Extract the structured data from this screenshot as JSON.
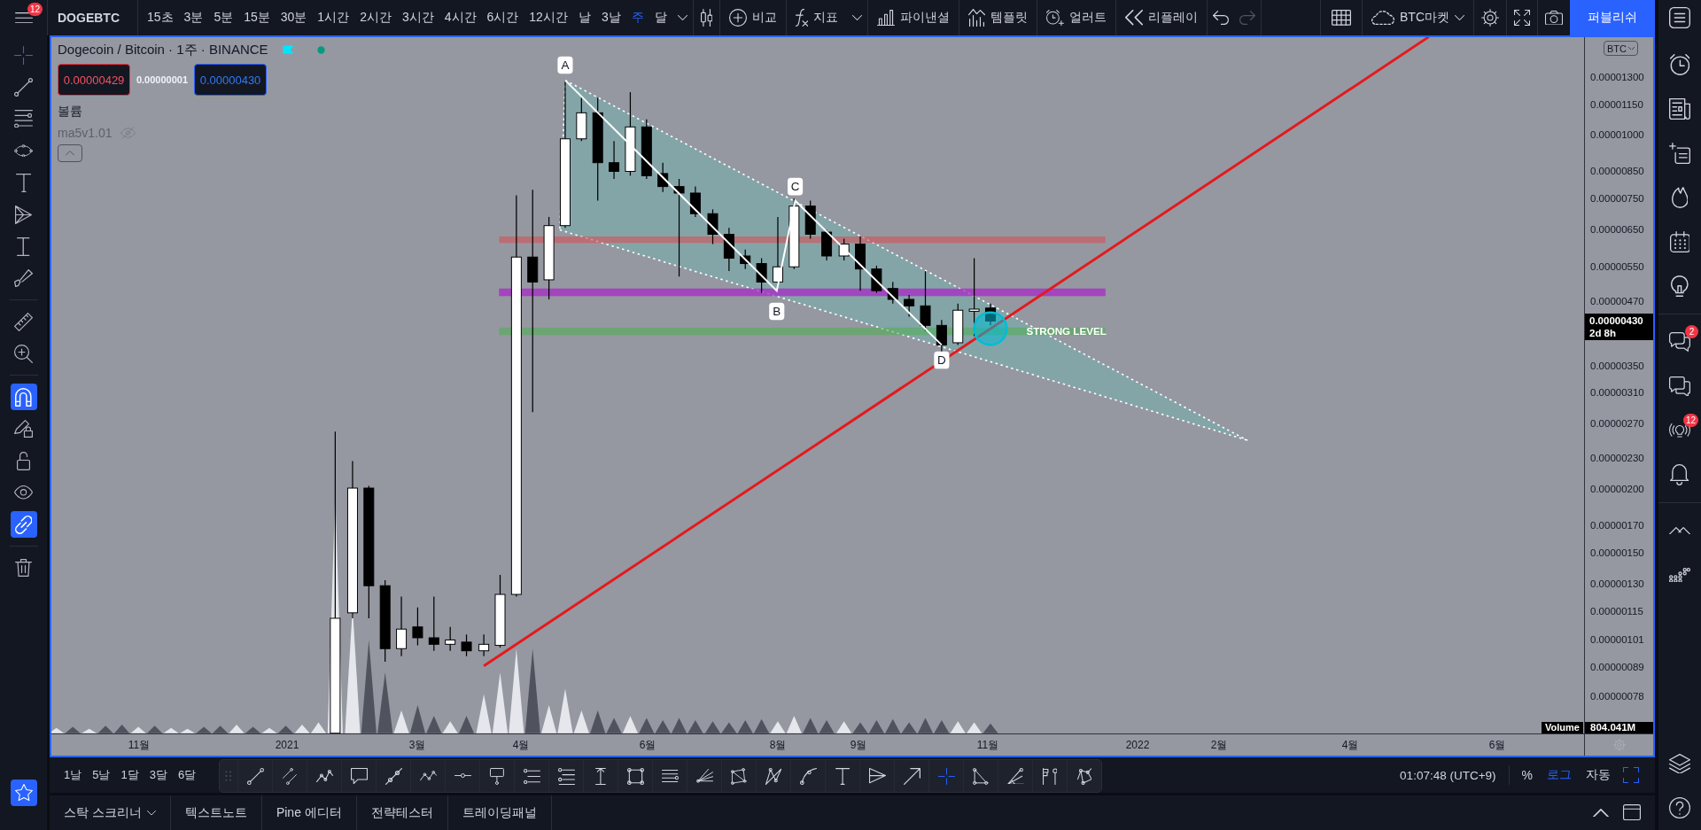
{
  "top_bar": {
    "menu_badge": "12",
    "symbol": "DOGEBTC",
    "intervals": [
      {
        "label": "15초",
        "selected": false
      },
      {
        "label": "3분",
        "selected": false
      },
      {
        "label": "5분",
        "selected": false
      },
      {
        "label": "15분",
        "selected": false
      },
      {
        "label": "30분",
        "selected": false
      },
      {
        "label": "1시간",
        "selected": false
      },
      {
        "label": "2시간",
        "selected": false
      },
      {
        "label": "3시간",
        "selected": false
      },
      {
        "label": "4시간",
        "selected": false
      },
      {
        "label": "6시간",
        "selected": false
      },
      {
        "label": "12시간",
        "selected": false
      },
      {
        "label": "날",
        "selected": false
      },
      {
        "label": "3날",
        "selected": false
      },
      {
        "label": "주",
        "selected": true
      },
      {
        "label": "달",
        "selected": false
      }
    ],
    "tools": [
      {
        "kind": "compare",
        "label": "비교",
        "dropdown": false
      },
      {
        "kind": "indicators",
        "label": "지표",
        "dropdown": true
      },
      {
        "kind": "financials",
        "label": "파이낸셜",
        "dropdown": false
      },
      {
        "kind": "templates",
        "label": "템플릿",
        "dropdown": false
      },
      {
        "kind": "alert",
        "label": "얼러트",
        "dropdown": false
      },
      {
        "kind": "replay",
        "label": "리플레이",
        "dropdown": false
      }
    ],
    "history": [
      {
        "kind": "undo",
        "disabled": false
      },
      {
        "kind": "redo",
        "disabled": true
      }
    ],
    "market": "BTC마켓",
    "publish": "퍼블리쉬"
  },
  "left_toolbar": {
    "tools": [
      {
        "kind": "crosshair",
        "selected": true
      },
      {
        "kind": "trendline",
        "selected": false
      },
      {
        "kind": "fiblines",
        "selected": false
      },
      {
        "kind": "ellipse",
        "selected": false
      },
      {
        "kind": "text",
        "selected": false
      },
      {
        "kind": "pattern",
        "selected": false
      },
      {
        "kind": "range",
        "selected": false
      },
      {
        "kind": "brush",
        "selected": false
      }
    ],
    "measure": [
      {
        "kind": "ruler"
      },
      {
        "kind": "zoom"
      }
    ],
    "toggles": [
      {
        "kind": "magnet",
        "on": true
      },
      {
        "kind": "drawlock",
        "on": false
      },
      {
        "kind": "lock",
        "on": false
      },
      {
        "kind": "eye",
        "on": false
      },
      {
        "kind": "link",
        "on": true
      }
    ],
    "actions": [
      {
        "kind": "trash"
      }
    ],
    "favorites": {
      "on": true
    }
  },
  "chart": {
    "title": "Dogecoin / Bitcoin · 1주 · BINANCE",
    "sell_price": "0.00000429",
    "spread": "0.00000001",
    "buy_price": "0.00000430",
    "indicators": [
      {
        "name": "볼륨",
        "hidden": false
      },
      {
        "name": "ma5v1.01",
        "hidden": true
      }
    ],
    "currency": "BTC",
    "price_ticks": [
      "0.00001300",
      "0.00001150",
      "0.00001000",
      "0.00000850",
      "0.00000750",
      "0.00000650",
      "0.00000550",
      "0.00000470",
      "0.00000350",
      "0.00000310",
      "0.00000270",
      "0.00000230",
      "0.00000200",
      "0.00000170",
      "0.00000150",
      "0.00000130",
      "0.00000115",
      "0.00000101",
      "0.00000089",
      "0.00000078"
    ],
    "last_price": "0.00000430",
    "countdown": "2d 8h",
    "volume_label": "Volume",
    "volume_value": "804.041M",
    "time_ticks": [
      "11월",
      "2021",
      "3월",
      "4월",
      "6월",
      "8월",
      "9월",
      "11월",
      "2022",
      "2월",
      "4월",
      "6월"
    ],
    "points": [
      "A",
      "B",
      "C",
      "D"
    ],
    "level_label": "STRONG LEVEL"
  },
  "drawing_toolbar": [
    {
      "kind": "trendline",
      "selected": false
    },
    {
      "kind": "parallel",
      "selected": false
    },
    {
      "kind": "wave",
      "selected": false
    },
    {
      "kind": "callout",
      "selected": false
    },
    {
      "kind": "segment",
      "selected": false
    },
    {
      "kind": "abcd",
      "selected": false
    },
    {
      "kind": "hline",
      "selected": false
    },
    {
      "kind": "signpost",
      "selected": false
    },
    {
      "kind": "fibretrace",
      "selected": false
    },
    {
      "kind": "fibext",
      "selected": false
    },
    {
      "kind": "pricerange",
      "selected": false
    },
    {
      "kind": "rectangle",
      "selected": false
    },
    {
      "kind": "hlines",
      "selected": false
    },
    {
      "kind": "fanlines",
      "selected": false
    },
    {
      "kind": "polygon",
      "selected": false
    },
    {
      "kind": "xabcd",
      "selected": false
    },
    {
      "kind": "arc",
      "selected": false
    },
    {
      "kind": "text",
      "selected": false
    },
    {
      "kind": "trianglepattern",
      "selected": false
    },
    {
      "kind": "arrow",
      "selected": false
    },
    {
      "kind": "crosshair",
      "selected": true
    },
    {
      "kind": "triangle",
      "selected": false
    },
    {
      "kind": "gannfan",
      "selected": false
    },
    {
      "kind": "flagpin",
      "selected": false
    },
    {
      "kind": "pathnodes",
      "selected": false
    }
  ],
  "bottom_bar": {
    "ranges": [
      "1날",
      "5날",
      "1달",
      "3달",
      "6달"
    ],
    "clock": "01:07:48 (UTC+9)",
    "scales": [
      {
        "label": "%",
        "selected": false
      },
      {
        "label": "로그",
        "selected": true
      },
      {
        "label": "자동",
        "selected": false
      }
    ]
  },
  "bottom_panel": {
    "tabs": [
      {
        "label": "스탁 스크리너",
        "dropdown": true
      },
      {
        "label": "텍스트노트",
        "dropdown": false
      },
      {
        "label": "Pine 에디터",
        "dropdown": false
      },
      {
        "label": "전략테스터",
        "dropdown": false
      },
      {
        "label": "트레이딩패널",
        "dropdown": false
      }
    ]
  },
  "right_sidebar": {
    "top": {
      "kind": "list"
    },
    "sections": [
      {
        "items": [
          {
            "kind": "alarm"
          },
          {
            "kind": "news"
          },
          {
            "kind": "addlist"
          },
          {
            "kind": "fire"
          },
          {
            "kind": "calendar"
          },
          {
            "kind": "bulb"
          }
        ]
      },
      {
        "items": [
          {
            "kind": "chats",
            "badge": "2"
          },
          {
            "kind": "chat"
          },
          {
            "kind": "streams",
            "badge": "12"
          },
          {
            "kind": "bell"
          }
        ]
      },
      {
        "items": [
          {
            "kind": "zigzag"
          },
          {
            "kind": "dots"
          }
        ]
      }
    ],
    "bottom": [
      {
        "kind": "layers"
      },
      {
        "kind": "help"
      }
    ]
  }
}
